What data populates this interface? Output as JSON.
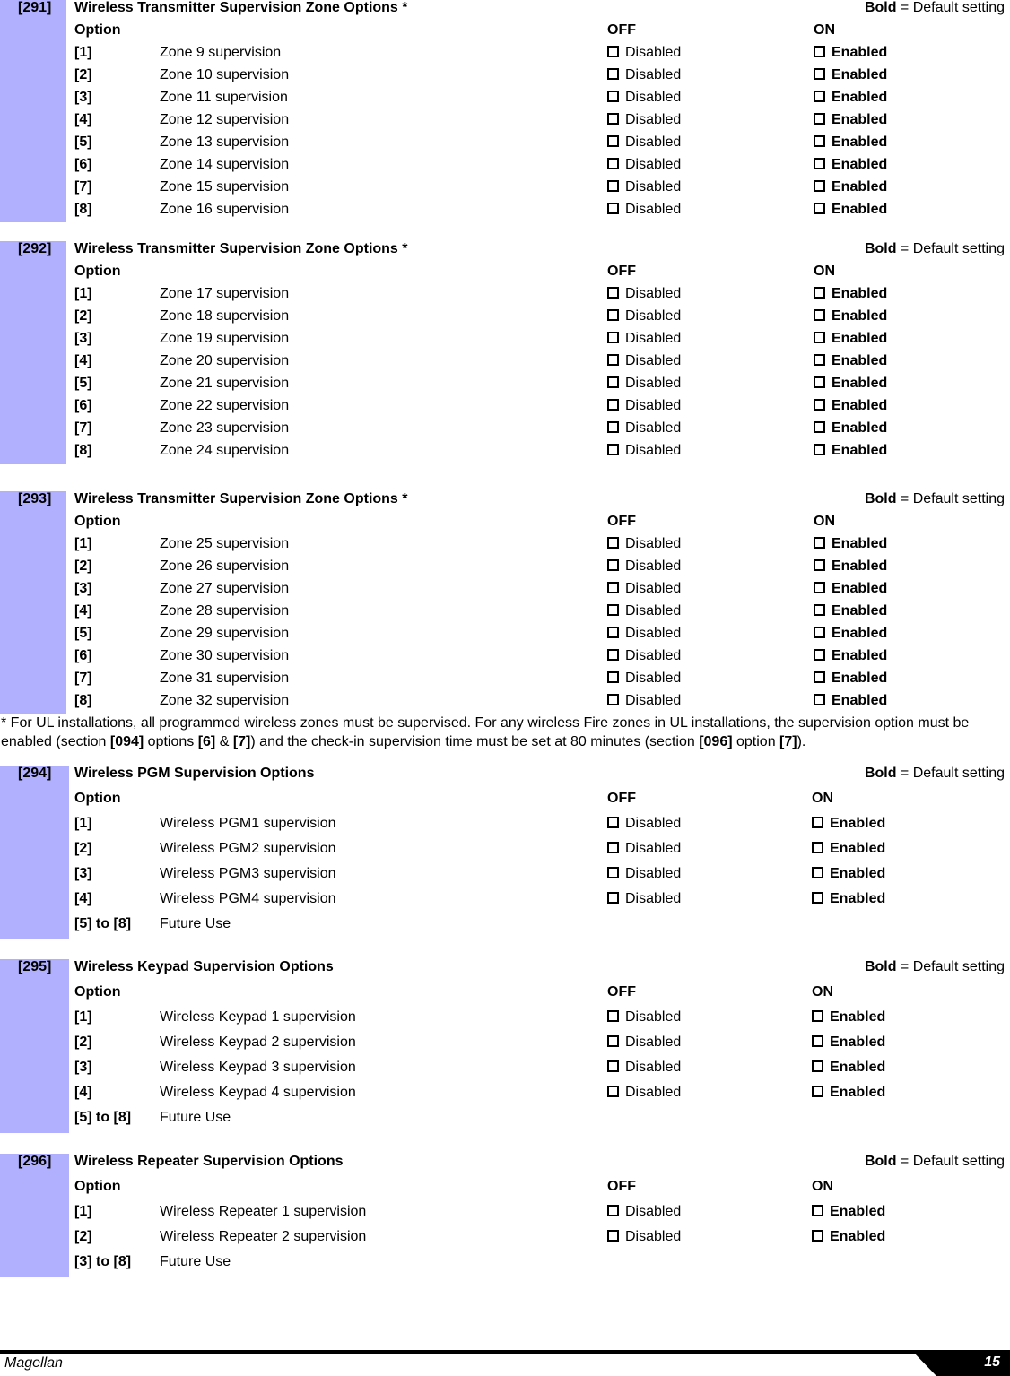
{
  "colors": {
    "sidebar": "#b0b0ff",
    "footer": "#000000"
  },
  "legend": {
    "bold": "Bold",
    "rest": " = Default setting"
  },
  "headers": {
    "option": "Option",
    "off": "OFF",
    "on": "ON"
  },
  "sections": [
    {
      "number": "[291]",
      "title": "Wireless Transmitter Supervision Zone Options *",
      "rows": [
        {
          "option": "[1]",
          "description": "Zone 9 supervision",
          "off": "Disabled",
          "on": "Enabled"
        },
        {
          "option": "[2]",
          "description": "Zone 10 supervision",
          "off": "Disabled",
          "on": "Enabled"
        },
        {
          "option": "[3]",
          "description": "Zone 11 supervision",
          "off": "Disabled",
          "on": "Enabled"
        },
        {
          "option": "[4]",
          "description": "Zone 12 supervision",
          "off": "Disabled",
          "on": "Enabled"
        },
        {
          "option": "[5]",
          "description": "Zone 13 supervision",
          "off": "Disabled",
          "on": "Enabled"
        },
        {
          "option": "[6]",
          "description": "Zone 14 supervision",
          "off": "Disabled",
          "on": "Enabled"
        },
        {
          "option": "[7]",
          "description": "Zone 15 supervision",
          "off": "Disabled",
          "on": "Enabled"
        },
        {
          "option": "[8]",
          "description": "Zone 16 supervision",
          "off": "Disabled",
          "on": "Enabled"
        }
      ]
    },
    {
      "number": "[292]",
      "title": "Wireless Transmitter Supervision Zone Options *",
      "rows": [
        {
          "option": "[1]",
          "description": "Zone 17 supervision",
          "off": "Disabled",
          "on": "Enabled"
        },
        {
          "option": "[2]",
          "description": "Zone 18 supervision",
          "off": "Disabled",
          "on": "Enabled"
        },
        {
          "option": "[3]",
          "description": "Zone 19 supervision",
          "off": "Disabled",
          "on": "Enabled"
        },
        {
          "option": "[4]",
          "description": "Zone 20 supervision",
          "off": "Disabled",
          "on": "Enabled"
        },
        {
          "option": "[5]",
          "description": "Zone 21 supervision",
          "off": "Disabled",
          "on": "Enabled"
        },
        {
          "option": "[6]",
          "description": "Zone 22 supervision",
          "off": "Disabled",
          "on": "Enabled"
        },
        {
          "option": "[7]",
          "description": "Zone 23 supervision",
          "off": "Disabled",
          "on": "Enabled"
        },
        {
          "option": "[8]",
          "description": "Zone 24 supervision",
          "off": "Disabled",
          "on": "Enabled"
        }
      ]
    },
    {
      "number": "[293]",
      "title": "Wireless Transmitter Supervision Zone Options *",
      "rows": [
        {
          "option": "[1]",
          "description": "Zone 25 supervision",
          "off": "Disabled",
          "on": "Enabled"
        },
        {
          "option": "[2]",
          "description": "Zone 26 supervision",
          "off": "Disabled",
          "on": "Enabled"
        },
        {
          "option": "[3]",
          "description": "Zone 27 supervision",
          "off": "Disabled",
          "on": "Enabled"
        },
        {
          "option": "[4]",
          "description": "Zone 28 supervision",
          "off": "Disabled",
          "on": "Enabled"
        },
        {
          "option": "[5]",
          "description": "Zone 29 supervision",
          "off": "Disabled",
          "on": "Enabled"
        },
        {
          "option": "[6]",
          "description": "Zone 30 supervision",
          "off": "Disabled",
          "on": "Enabled"
        },
        {
          "option": "[7]",
          "description": "Zone 31 supervision",
          "off": "Disabled",
          "on": "Enabled"
        },
        {
          "option": "[8]",
          "description": "Zone 32 supervision",
          "off": "Disabled",
          "on": "Enabled"
        }
      ]
    },
    {
      "number": "[294]",
      "title": "Wireless PGM Supervision Options",
      "rows": [
        {
          "option": "[1]",
          "description": "Wireless PGM1 supervision",
          "off": "Disabled",
          "on": "Enabled"
        },
        {
          "option": "[2]",
          "description": "Wireless PGM2 supervision",
          "off": "Disabled",
          "on": "Enabled"
        },
        {
          "option": "[3]",
          "description": "Wireless PGM3 supervision",
          "off": "Disabled",
          "on": "Enabled"
        },
        {
          "option": "[4]",
          "description": "Wireless PGM4 supervision",
          "off": "Disabled",
          "on": "Enabled"
        },
        {
          "option": "[5] to [8]",
          "description": "Future Use"
        }
      ]
    },
    {
      "number": "[295]",
      "title": "Wireless Keypad Supervision Options",
      "rows": [
        {
          "option": "[1]",
          "description": "Wireless Keypad 1 supervision",
          "off": "Disabled",
          "on": "Enabled"
        },
        {
          "option": "[2]",
          "description": "Wireless Keypad 2 supervision",
          "off": "Disabled",
          "on": "Enabled"
        },
        {
          "option": "[3]",
          "description": "Wireless Keypad 3 supervision",
          "off": "Disabled",
          "on": "Enabled"
        },
        {
          "option": "[4]",
          "description": "Wireless Keypad 4 supervision",
          "off": "Disabled",
          "on": "Enabled"
        },
        {
          "option": "[5] to [8]",
          "description": "Future Use"
        }
      ]
    },
    {
      "number": "[296]",
      "title": "Wireless Repeater Supervision Options",
      "rows": [
        {
          "option": "[1]",
          "description": "Wireless Repeater 1 supervision",
          "off": "Disabled",
          "on": "Enabled"
        },
        {
          "option": "[2]",
          "description": "Wireless Repeater 2 supervision",
          "off": "Disabled",
          "on": "Enabled"
        },
        {
          "option": "[3] to [8]",
          "description": "Future Use"
        }
      ]
    }
  ],
  "note": {
    "parts": [
      {
        "text": "* For UL installations, all programmed wireless zones must be supervised. For any wireless Fire zones in UL installations, the supervision option must be enabled (section ",
        "bold": false
      },
      {
        "text": "[094]",
        "bold": true
      },
      {
        "text": " options ",
        "bold": false
      },
      {
        "text": "[6]",
        "bold": true
      },
      {
        "text": " & ",
        "bold": false
      },
      {
        "text": "[7]",
        "bold": true
      },
      {
        "text": ") and the check-in supervision time must be set at 80 minutes (section ",
        "bold": false
      },
      {
        "text": "[096]",
        "bold": true
      },
      {
        "text": " option ",
        "bold": false
      },
      {
        "text": "[7]",
        "bold": true
      },
      {
        "text": ").",
        "bold": false
      }
    ]
  },
  "footer": {
    "title": "Magellan",
    "page_number": "15"
  }
}
